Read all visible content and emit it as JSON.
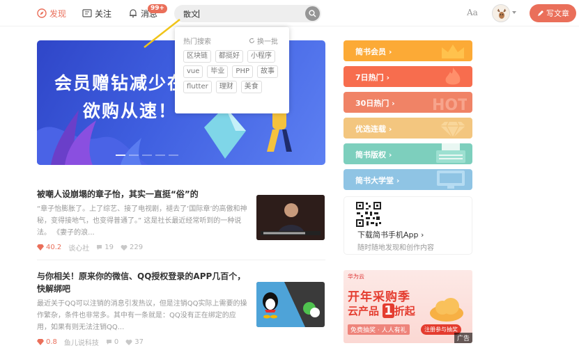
{
  "nav": {
    "discover": "发现",
    "follow": "关注",
    "messages": "消息",
    "messages_badge": "99+",
    "font_toggle": "Aa",
    "write": "写文章"
  },
  "search": {
    "value": "散文"
  },
  "hot_search": {
    "title": "热门搜索",
    "refresh": "换一批",
    "tags": [
      "区块链",
      "都挺好",
      "小程序",
      "vue",
      "毕业",
      "PHP",
      "故事",
      "flutter",
      "理财",
      "美食"
    ]
  },
  "banner": {
    "line1": "会员赠钻减少在",
    "line2": "欲购从速！",
    "slide_count": 5,
    "active_slide": 1
  },
  "articles": [
    {
      "title": "被嘲人设崩塌的章子怡，其实一直挺“俗”的",
      "abstract": "“章子怡膨胀了。上了综艺、接了电视剧，褪去了‘国际章’的高傲和神秘，变得接地气，也变得普通了。” 这是社长最近经常听到的一种说法。 《妻子的浪...",
      "diamonds": "40.2",
      "author": "谈心社",
      "comments": "19",
      "likes": "229"
    },
    {
      "title": "与你相关！原来你的微信、QQ授权登录的APP几百个，快解绑吧",
      "abstract": "最近关于QQ可以注销的消息引发热议，但是注销QQ实际上需要的操作繁杂，条件也非常多。其中有一条就是：QQ没有正在绑定的应用，如果有则无法注销QQ...",
      "diamonds": "0.8",
      "author": "鱼儿说科技",
      "comments": "0",
      "likes": "37"
    }
  ],
  "sidebar": {
    "items": [
      {
        "label": "简书会员",
        "color": "#fcaa36"
      },
      {
        "label": "7日热门",
        "color": "#f76d4e"
      },
      {
        "label": "30日热门",
        "color": "#f08366"
      },
      {
        "label": "优选连载",
        "color": "#f3c67f"
      },
      {
        "label": "简书版权",
        "color": "#7dcfbd"
      },
      {
        "label": "简书大学堂",
        "color": "#8fc4e4"
      }
    ],
    "app": {
      "title": "下载简书手机App",
      "subtitle": "随时随地发现和创作内容"
    }
  },
  "ad": {
    "brand": "华为云",
    "headline": "开年采购季",
    "product": "云产品",
    "discount": "1",
    "discount_unit": "折起",
    "slogan": "免费抽奖 · 人人有礼",
    "cta": "注册参与抽奖",
    "tag": "广告"
  }
}
